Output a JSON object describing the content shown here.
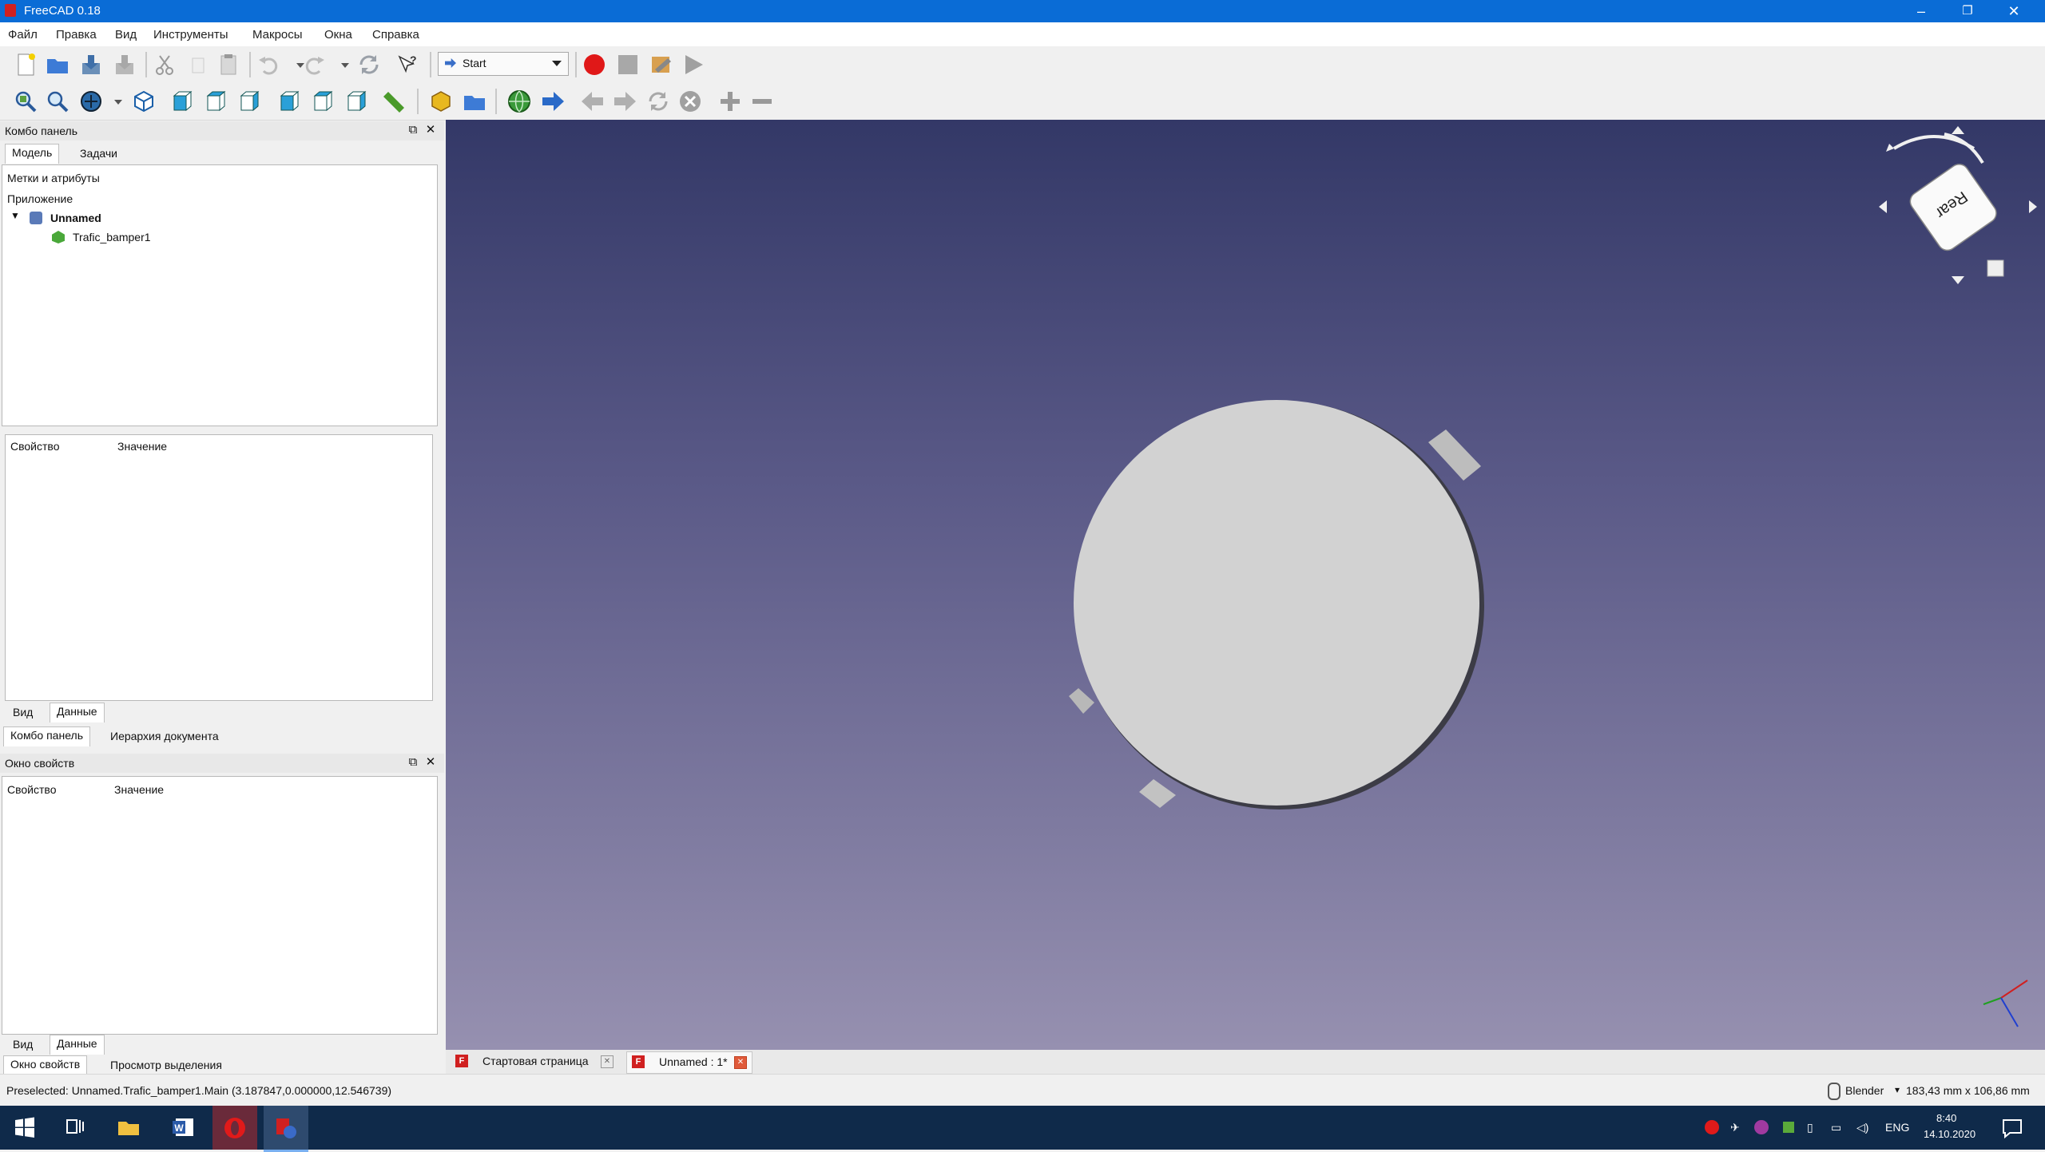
{
  "window": {
    "title": "FreeCAD 0.18",
    "minimize": "–",
    "restore": "❐",
    "close": "✕"
  },
  "menu": [
    "Файл",
    "Правка",
    "Вид",
    "Инструменты",
    "Макросы",
    "Окна",
    "Справка"
  ],
  "toolbar": {
    "workbench": "Start"
  },
  "combo_panel": {
    "title": "Комбо панель",
    "tabs": [
      "Модель",
      "Задачи"
    ],
    "tree_header": "Метки и атрибуты",
    "app_label": "Приложение",
    "doc_name": "Unnamed",
    "object_name": "Trafic_bamper1",
    "prop_col1": "Свойство",
    "prop_col2": "Значение",
    "view_tabs": [
      "Вид",
      "Данные"
    ],
    "bottom_tabs": [
      "Комбо панель",
      "Иерархия документа"
    ]
  },
  "property_panel": {
    "title": "Окно свойств",
    "col1": "Свойство",
    "col2": "Значение",
    "view_tabs": [
      "Вид",
      "Данные"
    ],
    "bottom_tabs": [
      "Окно свойств",
      "Просмотр выделения"
    ]
  },
  "navcube": {
    "face": "Rear"
  },
  "doc_tabs": [
    "Стартовая страница",
    "Unnamed : 1*"
  ],
  "status": {
    "preselect": "Preselected: Unnamed.Trafic_bamper1.Main (3.187847,0.000000,12.546739)",
    "nav_style": "Blender",
    "dimensions": "183,43 mm x 106,86 mm"
  },
  "taskbar": {
    "lang": "ENG",
    "time": "8:40",
    "date": "14.10.2020"
  },
  "colors": {
    "titlebar": "#0a6cd6",
    "viewport_top": "#333867",
    "viewport_bottom": "#9690b0",
    "part": "#cfcfcf"
  }
}
